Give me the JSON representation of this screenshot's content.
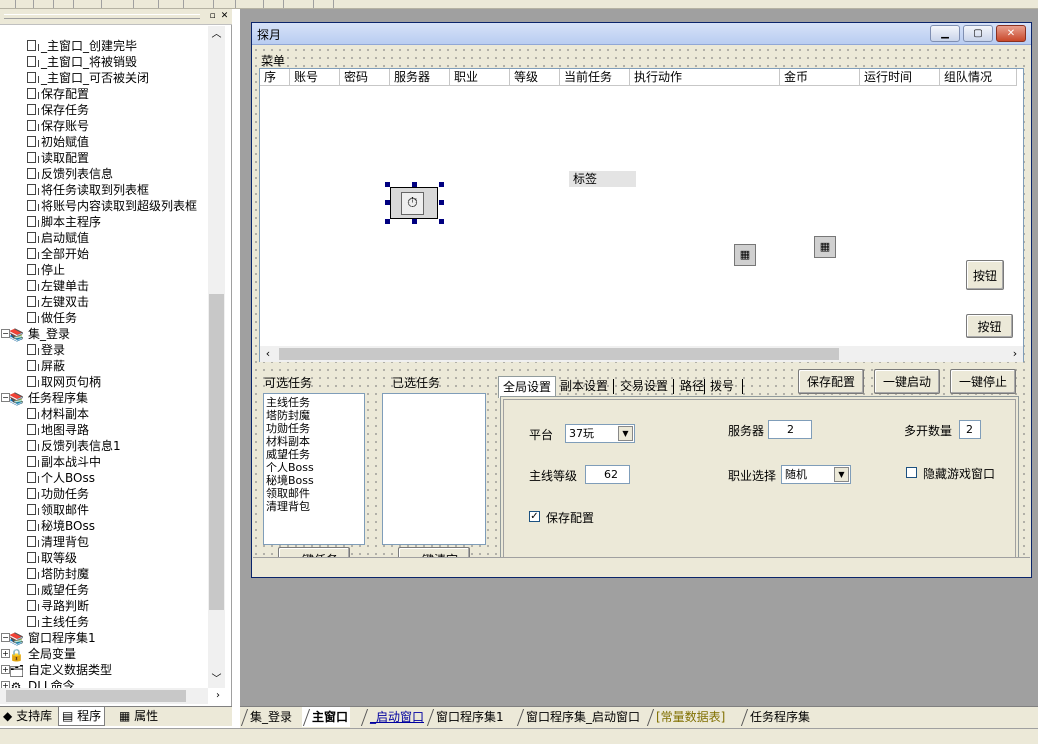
{
  "tree": {
    "items": [
      {
        "label": "_主窗口_创建完毕",
        "icon": "sub-icon"
      },
      {
        "label": "_主窗口_将被销毁",
        "icon": "sub-icon"
      },
      {
        "label": "_主窗口_可否被关闭",
        "icon": "sub-icon"
      },
      {
        "label": "保存配置",
        "icon": "sub-icon"
      },
      {
        "label": "保存任务",
        "icon": "sub-icon"
      },
      {
        "label": "保存账号",
        "icon": "sub-icon"
      },
      {
        "label": "初始赋值",
        "icon": "sub-icon"
      },
      {
        "label": "读取配置",
        "icon": "sub-icon"
      },
      {
        "label": "反馈列表信息",
        "icon": "sub-icon"
      },
      {
        "label": "将任务读取到列表框",
        "icon": "sub-icon"
      },
      {
        "label": "将账号内容读取到超级列表框",
        "icon": "sub-icon"
      },
      {
        "label": "脚本主程序",
        "icon": "sub-icon"
      },
      {
        "label": "启动赋值",
        "icon": "sub-icon"
      },
      {
        "label": "全部开始",
        "icon": "sub-icon"
      },
      {
        "label": "停止",
        "icon": "sub-icon"
      },
      {
        "label": "左键单击",
        "icon": "sub-icon"
      },
      {
        "label": "左键双击",
        "icon": "sub-icon"
      },
      {
        "label": "做任务",
        "icon": "sub-icon"
      },
      {
        "label": "集_登录",
        "icon": "set-icon",
        "group": true
      },
      {
        "label": "登录",
        "icon": "sub-icon"
      },
      {
        "label": "屏蔽",
        "icon": "sub-icon"
      },
      {
        "label": "取网页句柄",
        "icon": "sub-icon"
      },
      {
        "label": "任务程序集",
        "icon": "set-icon",
        "group": true
      },
      {
        "label": "材料副本",
        "icon": "sub-icon"
      },
      {
        "label": "地图寻路",
        "icon": "sub-icon"
      },
      {
        "label": "反馈列表信息1",
        "icon": "sub-icon"
      },
      {
        "label": "副本战斗中",
        "icon": "sub-icon"
      },
      {
        "label": "个人BOss",
        "icon": "sub-icon"
      },
      {
        "label": "功勋任务",
        "icon": "sub-icon"
      },
      {
        "label": "领取邮件",
        "icon": "sub-icon"
      },
      {
        "label": "秘境BOss",
        "icon": "sub-icon"
      },
      {
        "label": "清理背包",
        "icon": "sub-icon"
      },
      {
        "label": "取等级",
        "icon": "sub-icon"
      },
      {
        "label": "塔防封魔",
        "icon": "sub-icon"
      },
      {
        "label": "威望任务",
        "icon": "sub-icon"
      },
      {
        "label": "寻路判断",
        "icon": "sub-icon"
      },
      {
        "label": "主线任务",
        "icon": "sub-icon"
      },
      {
        "label": "窗口程序集1",
        "icon": "set-icon",
        "group": true
      },
      {
        "label": "全局变量",
        "icon": "globals-icon",
        "group": true
      },
      {
        "label": "自定义数据类型",
        "icon": "types-icon",
        "group": true
      },
      {
        "label": "DLL命令",
        "icon": "dll-icon",
        "group": true
      }
    ]
  },
  "left_tabs": {
    "support": "支持库",
    "program": "程序",
    "property": "属性"
  },
  "form": {
    "title": "探月",
    "menu": "菜单",
    "columns": [
      "序",
      "账号",
      "密码",
      "服务器",
      "职业",
      "等级",
      "当前任务",
      "执行动作",
      "金币",
      "运行时间",
      "组队情况"
    ],
    "tag_label": "标签",
    "button_label": "按钮",
    "available_tasks_label": "可选任务",
    "selected_tasks_label": "已选任务",
    "available_tasks": [
      "主线任务",
      "塔防封魔",
      "功勋任务",
      "材料副本",
      "威望任务",
      "个人Boss",
      "秘境Boss",
      "领取邮件",
      "清理背包"
    ],
    "one_key_task": "一键任务",
    "one_key_clear": "一键清空",
    "tabs": [
      "全局设置",
      "副本设置",
      "交易设置",
      "路径",
      "拨号"
    ],
    "save_config_btn": "保存配置",
    "start_btn": "一键启动",
    "stop_btn": "一键停止",
    "settings": {
      "platform_label": "平台",
      "platform_value": "37玩",
      "server_label": "服务器",
      "server_value": "2",
      "multi_label": "多开数量",
      "multi_value": "2",
      "level_label": "主线等级",
      "level_value": "62",
      "job_label": "职业选择",
      "job_value": "随机",
      "hide_label": "隐藏游戏窗口",
      "save_label": "保存配置",
      "save_checked": true,
      "hide_checked": false
    }
  },
  "doc_tabs": [
    "集_登录",
    "主窗口",
    "_启动窗口",
    "窗口程序集1",
    "窗口程序集_启动窗口",
    "[常量数据表]",
    "任务程序集"
  ],
  "active_doc_tab": "主窗口",
  "colors": {
    "accent_tab": "#807000",
    "selection_handle": "#000080",
    "title_gradient": "#b9cdf1"
  }
}
